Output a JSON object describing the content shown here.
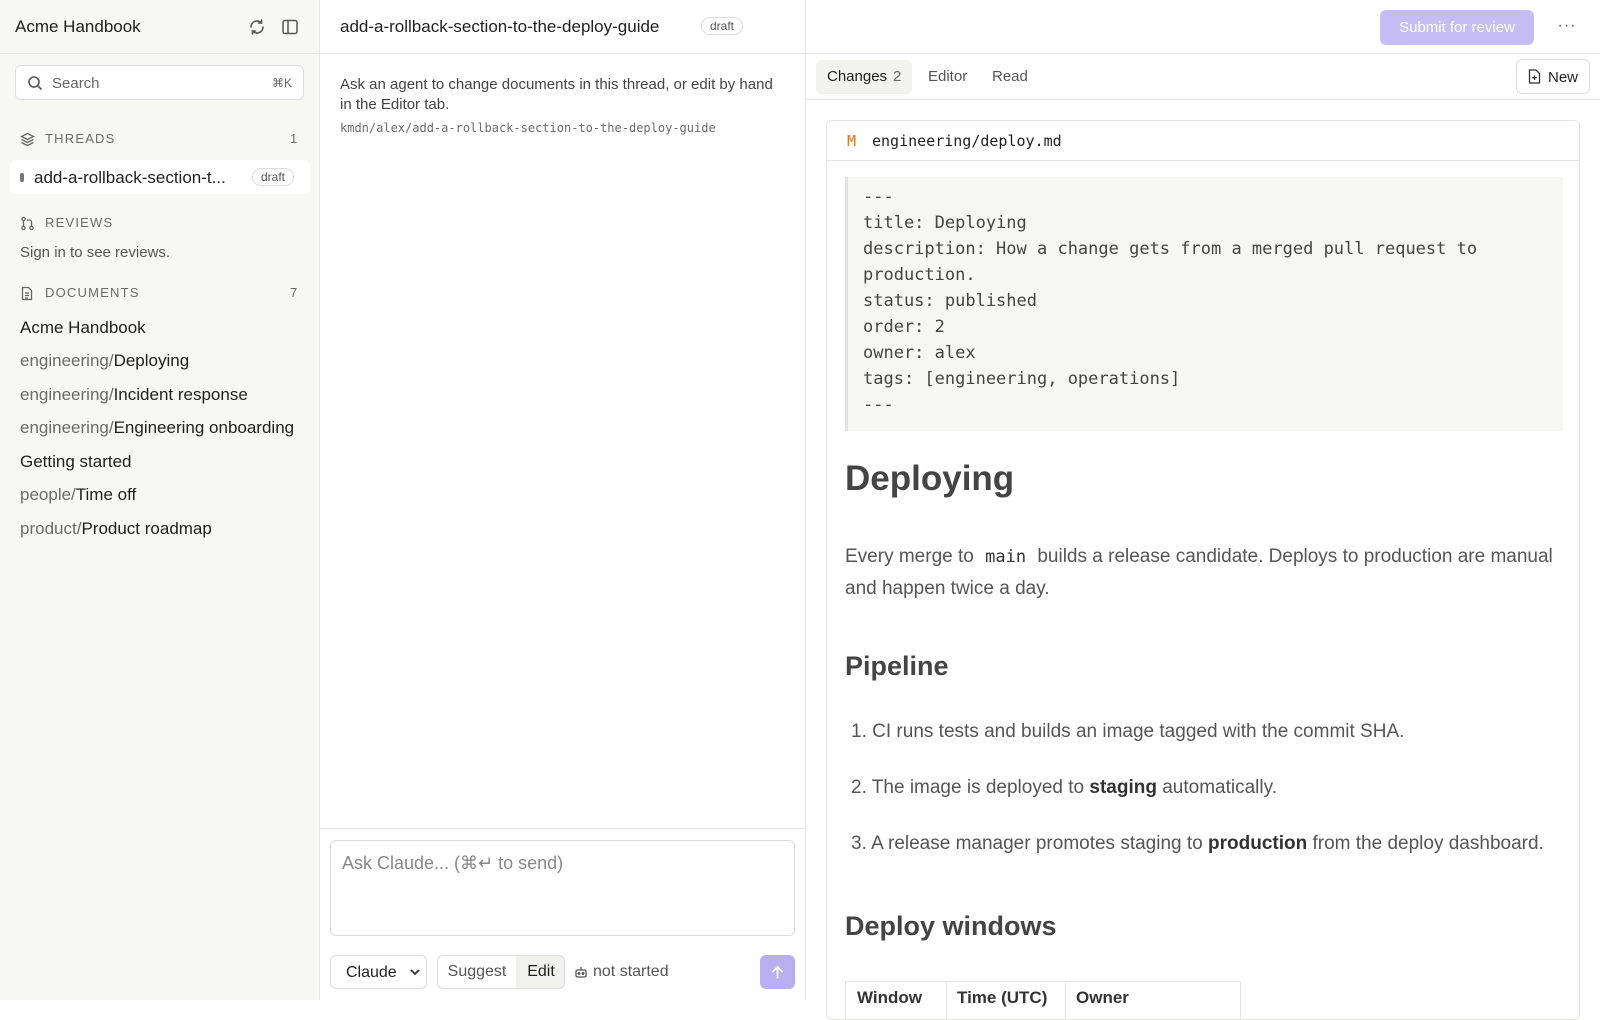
{
  "sidebar": {
    "title": "Acme Handbook",
    "search": {
      "placeholder": "Search",
      "shortcut": "⌘K"
    },
    "threads": {
      "label": "THREADS",
      "count": "1",
      "items": [
        {
          "name": "add-a-rollback-section-t...",
          "badge": "draft"
        }
      ]
    },
    "reviews": {
      "label": "REVIEWS",
      "note": "Sign in to see reviews."
    },
    "documents": {
      "label": "DOCUMENTS",
      "count": "7",
      "items": [
        {
          "prefix": "",
          "name": "Acme Handbook"
        },
        {
          "prefix": "engineering/",
          "name": "Deploying"
        },
        {
          "prefix": "engineering/",
          "name": "Incident response"
        },
        {
          "prefix": "engineering/",
          "name": "Engineering onboarding"
        },
        {
          "prefix": "",
          "name": "Getting started"
        },
        {
          "prefix": "people/",
          "name": "Time off"
        },
        {
          "prefix": "product/",
          "name": "Product roadmap"
        }
      ]
    }
  },
  "header": {
    "thread_title": "add-a-rollback-section-to-the-deploy-guide",
    "badge": "draft",
    "submit_label": "Submit for review",
    "more_label": "···"
  },
  "thread_panel": {
    "help_text": "Ask an agent to change documents in this thread, or edit by hand in the Editor tab.",
    "branch_path": "kmdn/alex/add-a-rollback-section-to-the-deploy-guide",
    "composer_placeholder": "Ask Claude... (⌘↵ to send)",
    "model": "Claude",
    "modes": [
      "Suggest",
      "Edit"
    ],
    "active_mode": "Edit",
    "status": "not started"
  },
  "review_panel": {
    "tabs": [
      {
        "label": "Changes",
        "count": "2"
      },
      {
        "label": "Editor",
        "count": ""
      },
      {
        "label": "Read",
        "count": ""
      }
    ],
    "new_label": "New",
    "file": {
      "status": "M",
      "path": "engineering/deploy.md",
      "frontmatter": [
        "---",
        "title: Deploying",
        "description: How a change gets from a merged pull request to",
        "production.",
        "status: published",
        "order: 2",
        "owner: alex",
        "tags: [engineering, operations]",
        "---"
      ],
      "heading": "Deploying",
      "intro": {
        "before": "Every merge to",
        "code": "main",
        "after": "builds a release candidate. Deploys to production are manual and happen twice a day."
      },
      "pipeline_heading": "Pipeline",
      "pipeline_steps": [
        {
          "num": "1.",
          "before": "CI runs tests and builds an image tagged with the commit SHA.",
          "bold": "",
          "after": ""
        },
        {
          "num": "2.",
          "before": "The image is deployed to",
          "bold": "staging",
          "after": "automatically."
        },
        {
          "num": "3.",
          "before": "A release manager promotes staging to",
          "bold": "production",
          "after": "from the deploy dashboard."
        }
      ],
      "windows_heading": "Deploy windows",
      "table_headers": [
        "Window",
        "Time (UTC)",
        "Owner"
      ]
    }
  }
}
